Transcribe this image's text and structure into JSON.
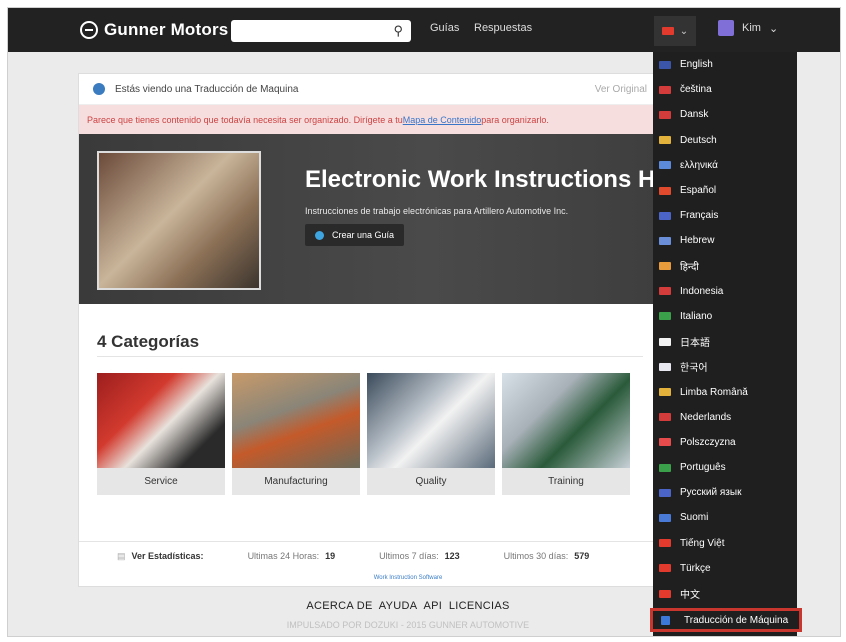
{
  "header": {
    "brand": "Gunner Motors",
    "nav": [
      "Guías",
      "Respuestas"
    ],
    "user_name": "Kim",
    "current_flag_color": "#e23b2e"
  },
  "translation_notice": {
    "text": "Estás viendo una Traducción de Maquina",
    "view_original": "Ver Original"
  },
  "warning": {
    "before": "Parece que tienes contenido que todavía necesita ser organizado. Dirígete a tu ",
    "link": "Mapa de Contenido",
    "after": " para organizarlo."
  },
  "hero": {
    "title": "Electronic Work Instructions H",
    "subtitle": "Instrucciones de trabajo electrónicas para Artillero Automotive Inc.",
    "button": "Crear una Guía"
  },
  "categories": {
    "title": "4 Categorías",
    "items": [
      "Service",
      "Manufacturing",
      "Quality",
      "Training"
    ]
  },
  "stats": {
    "label": "Ver Estadísticas:",
    "h24": "Ultimas 24 Horas:",
    "h24_val": "19",
    "d7": "Ultimos 7 días:",
    "d7_val": "123",
    "d30": "Ultimos 30 días:",
    "d30_val": "579"
  },
  "footer": {
    "link": "Work Instruction Software",
    "nav": [
      "ACERCA DE",
      "AYUDA",
      "API",
      "LICENCIAS"
    ],
    "copy": "IMPULSADO POR DOZUKI - 2015 GUNNER AUTOMOTIVE"
  },
  "languages": [
    {
      "label": "English",
      "flag": "#3b56a8"
    },
    {
      "label": "čeština",
      "flag": "#d43b3b"
    },
    {
      "label": "Dansk",
      "flag": "#d43b3b"
    },
    {
      "label": "Deutsch",
      "flag": "#e2b23a"
    },
    {
      "label": "ελληνικά",
      "flag": "#5d8ad8"
    },
    {
      "label": "Español",
      "flag": "#e24a2e"
    },
    {
      "label": "Français",
      "flag": "#4a64c8"
    },
    {
      "label": "Hebrew",
      "flag": "#6a8fd8"
    },
    {
      "label": "हिन्दी",
      "flag": "#e79b3a"
    },
    {
      "label": "Indonesia",
      "flag": "#d43b3b"
    },
    {
      "label": "Italiano",
      "flag": "#3aa04a"
    },
    {
      "label": "日本語",
      "flag": "#f2f2f2"
    },
    {
      "label": "한국어",
      "flag": "#e8e8f0"
    },
    {
      "label": "Limba Română",
      "flag": "#e2b23a"
    },
    {
      "label": "Nederlands",
      "flag": "#d43b3b"
    },
    {
      "label": "Polszczyzna",
      "flag": "#e84b4b"
    },
    {
      "label": "Português",
      "flag": "#3aa04a"
    },
    {
      "label": "Русский язык",
      "flag": "#4a64c8"
    },
    {
      "label": "Suomi",
      "flag": "#4a7ad8"
    },
    {
      "label": "Tiếng Việt",
      "flag": "#e23b2e"
    },
    {
      "label": "Türkçe",
      "flag": "#e23b2e"
    },
    {
      "label": "中文",
      "flag": "#e23b2e"
    }
  ],
  "machine_translation_toggle": "Traducción de Máquina"
}
